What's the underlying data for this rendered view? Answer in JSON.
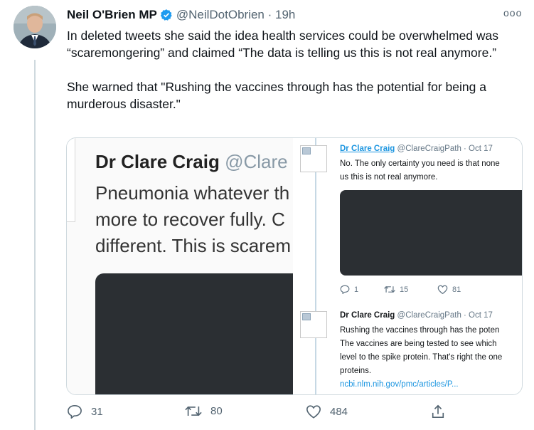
{
  "colors": {
    "text": "#0f1419",
    "secondary": "#536471",
    "verified": "#1d9bf0",
    "link": "#1b95e0",
    "dark_media": "#2b2f33"
  },
  "tweet": {
    "author": "Neil O'Brien MP",
    "handle_time": "@NeilDotObrien · 19h",
    "more_icon": "more-icon",
    "paragraphs": [
      "In deleted tweets she said the idea health services could be overwhelmed was “scaremongering” and claimed “The data is telling us this is not real anymore.”",
      "She warned that \"Rushing the vaccines through has the potential for being a murderous disaster.\""
    ],
    "actions": {
      "replies": "31",
      "retweets": "80",
      "likes": "484"
    }
  },
  "media": {
    "left": {
      "name": "Dr Clare Craig",
      "handle": "@Clare",
      "lines": [
        "Pneumonia whatever th",
        "more to recover fully. C",
        "different. This is scarem"
      ]
    },
    "right": {
      "tweet1": {
        "name": "Dr Clare Craig",
        "meta": "@ClareCraigPath · Oct 17",
        "lines": [
          "No. The only certainty you need is that none",
          "us this is not real anymore."
        ],
        "replies": "1",
        "retweets": "15",
        "likes": "81"
      },
      "tweet2": {
        "name": "Dr Clare Craig",
        "meta": "@ClareCraigPath · Oct 17",
        "lines": [
          "Rushing the vaccines through has the poten",
          "The vaccines are being tested to see which",
          "level to the spike protein. That's right the one",
          "proteins."
        ],
        "link": "ncbi.nlm.nih.gov/pmc/articles/P..."
      }
    }
  }
}
